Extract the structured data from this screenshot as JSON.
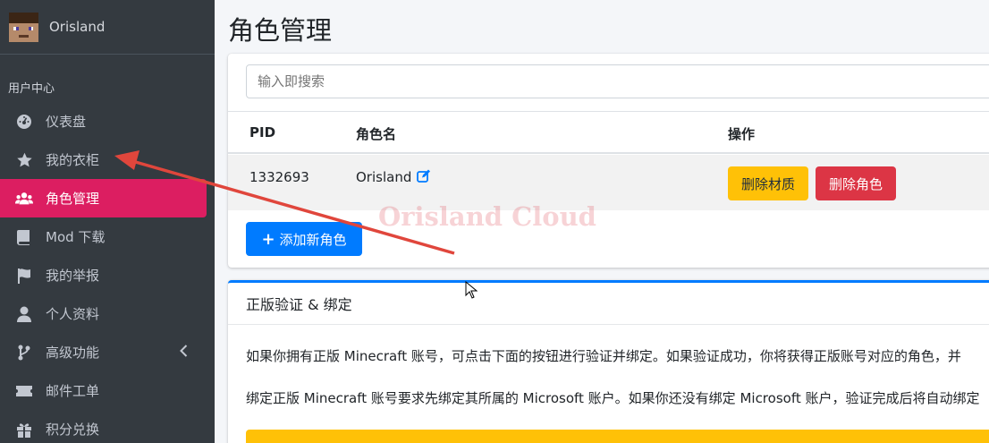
{
  "brand": {
    "name": "Orisland",
    "avatar_icon": "minecraft-steve-avatar"
  },
  "sidebar": {
    "section_header": "用户中心",
    "items": [
      {
        "label": "仪表盘",
        "icon": "dashboard-icon",
        "active": false
      },
      {
        "label": "我的衣柜",
        "icon": "star-icon",
        "active": false
      },
      {
        "label": "角色管理",
        "icon": "users-icon",
        "active": true
      },
      {
        "label": "Mod 下载",
        "icon": "book-icon",
        "active": false
      },
      {
        "label": "我的举报",
        "icon": "flag-icon",
        "active": false
      },
      {
        "label": "个人资料",
        "icon": "user-icon",
        "active": false
      },
      {
        "label": "高级功能",
        "icon": "fork-icon",
        "active": false,
        "expandable": true
      },
      {
        "label": "邮件工单",
        "icon": "ticket-icon",
        "active": false
      },
      {
        "label": "积分兑换",
        "icon": "gift-icon",
        "active": false
      }
    ]
  },
  "page": {
    "title": "角色管理"
  },
  "players": {
    "search_placeholder": "输入即搜索",
    "columns": {
      "pid": "PID",
      "name": "角色名",
      "actions": "操作"
    },
    "rows": [
      {
        "pid": "1332693",
        "name": "Orisland",
        "clear_texture_label": "删除材质",
        "delete_label": "删除角色"
      }
    ],
    "add_label": "添加新角色",
    "watermark": "Orisland Cloud"
  },
  "verify": {
    "title": "正版验证 & 绑定",
    "para1": "如果你拥有正版 Minecraft 账号，可点击下面的按钮进行验证并绑定。如果验证成功，你将获得正版账号对应的角色，并",
    "para2": "绑定正版 Minecraft 账号要求先绑定其所属的 Microsoft 账户。如果你还没有绑定 Microsoft 账户，验证完成后将自动绑定"
  },
  "colors": {
    "sidebar_bg": "#343a40",
    "active_item": "#dc1e61",
    "primary": "#007bff",
    "warning": "#ffc107",
    "danger": "#dc3545",
    "annotation_arrow": "#e0463c"
  }
}
